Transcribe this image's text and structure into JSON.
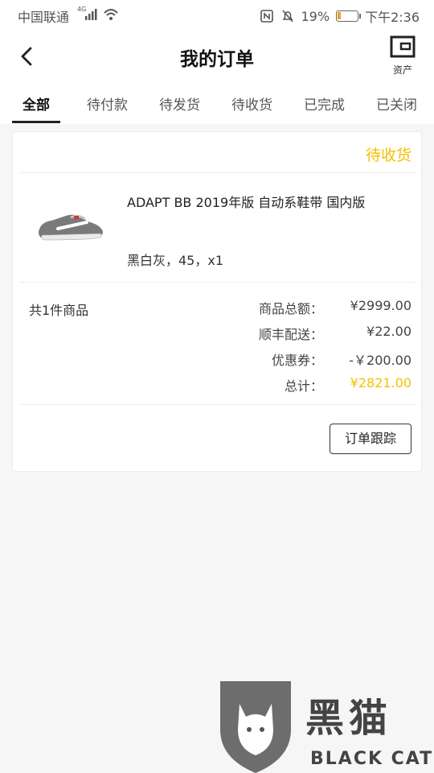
{
  "status_bar": {
    "carrier": "中国联通",
    "network": "4G",
    "battery": "19%",
    "time": "下午2:36"
  },
  "header": {
    "title": "我的订单",
    "asset_label": "资产"
  },
  "tabs": [
    "全部",
    "待付款",
    "待发货",
    "待收货",
    "已完成",
    "已关闭"
  ],
  "order": {
    "status": "待收货",
    "product_name": "ADAPT BB 2019年版 自动系鞋带 国内版",
    "spec": "黑白灰，45，x1",
    "item_count": "共1件商品",
    "summary": [
      {
        "label": "商品总额：",
        "value": "¥2999.00"
      },
      {
        "label": "顺丰配送：",
        "value": "¥22.00"
      },
      {
        "label": "优惠券：",
        "value": "-￥200.00"
      },
      {
        "label": "总计：",
        "value": "¥2821.00"
      }
    ],
    "track_button": "订单跟踪"
  },
  "watermark": {
    "cn": "黑猫",
    "en": "BLACK CAT"
  },
  "colors": {
    "accent": "#f3c200",
    "battery_low": "#f0a020"
  }
}
